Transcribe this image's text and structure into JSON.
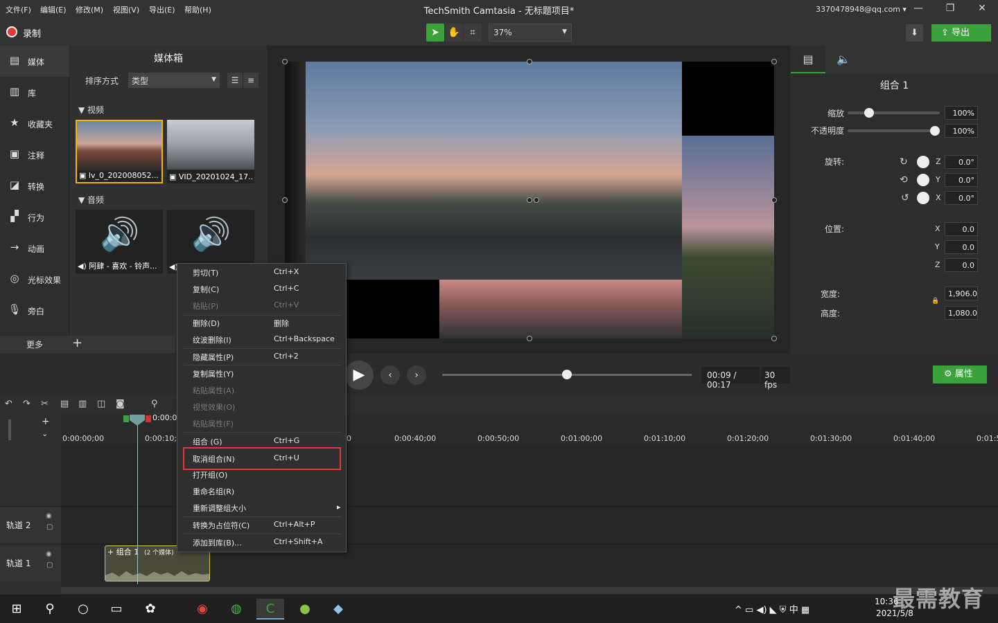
{
  "menubar": {
    "items": [
      "文件(F)",
      "编辑(E)",
      "修改(M)",
      "视图(V)",
      "导出(E)",
      "帮助(H)"
    ],
    "title": "TechSmith Camtasia - 无标题项目*",
    "account": "3370478948@qq.com ▾"
  },
  "toolbar": {
    "record": "录制",
    "zoom": "37%",
    "export": "导出"
  },
  "sidebar": {
    "items": [
      {
        "label": "媒体",
        "icon": "film-icon"
      },
      {
        "label": "库",
        "icon": "library-icon"
      },
      {
        "label": "收藏夹",
        "icon": "star-icon"
      },
      {
        "label": "注释",
        "icon": "annotation-icon"
      },
      {
        "label": "转换",
        "icon": "transition-icon"
      },
      {
        "label": "行为",
        "icon": "behavior-icon"
      },
      {
        "label": "动画",
        "icon": "animation-icon"
      },
      {
        "label": "光标效果",
        "icon": "cursor-icon"
      },
      {
        "label": "旁白",
        "icon": "microphone-icon"
      }
    ],
    "more": "更多"
  },
  "media_bin": {
    "title": "媒体箱",
    "sort_label": "排序方式",
    "sort_value": "类型",
    "video_section": "视频",
    "audio_section": "音频",
    "videos": [
      "lv_0_202008052...",
      "VID_20201024_17..."
    ],
    "audios": [
      "阿肆 - 喜欢 - 铃声...",
      ""
    ]
  },
  "properties": {
    "title": "组合 1",
    "scale_label": "缩放",
    "scale_value": "100%",
    "scale_fraction": 0.2,
    "opacity_label": "不透明度",
    "opacity_value": "100%",
    "opacity_fraction": 1.0,
    "rotation_label": "旋转:",
    "rotation": [
      {
        "axis": "Z",
        "value": "0.0°"
      },
      {
        "axis": "Y",
        "value": "0.0°"
      },
      {
        "axis": "X",
        "value": "0.0°"
      }
    ],
    "position_label": "位置:",
    "position": [
      {
        "axis": "X",
        "value": "0.0"
      },
      {
        "axis": "Y",
        "value": "0.0"
      },
      {
        "axis": "Z",
        "value": "0.0"
      }
    ],
    "width_label": "宽度:",
    "width_value": "1,906.0",
    "height_label": "高度:",
    "height_value": "1,080.0"
  },
  "playback": {
    "time": "00:09 / 00:17",
    "fps": "30 fps",
    "progress": 0.5,
    "properties_button": "属性"
  },
  "timeline": {
    "playhead_time": "0:00:0",
    "ticks": [
      "0:00:00;00",
      "0:00:10;0",
      "0",
      "0:00:40;00",
      "0:00:50;00",
      "0:01:00;00",
      "0:01:10;00",
      "0:01:20;00",
      "0:01:30;00",
      "0:01:40;00",
      "0:01:5"
    ],
    "tracks": [
      "轨道 2",
      "轨道 1"
    ],
    "clip_label": "+ 组合 1",
    "clip_sub": "(2 个媒体)"
  },
  "context_menu": {
    "items": [
      {
        "label": "剪切(T)",
        "key": "Ctrl+X",
        "disabled": false
      },
      {
        "label": "复制(C)",
        "key": "Ctrl+C",
        "disabled": false
      },
      {
        "label": "粘贴(P)",
        "key": "Ctrl+V",
        "disabled": true
      },
      {
        "label": "删除(D)",
        "key": "删除",
        "disabled": false
      },
      {
        "label": "纹波删除(I)",
        "key": "Ctrl+Backspace",
        "disabled": false
      },
      {
        "label": "隐藏属性(P)",
        "key": "Ctrl+2",
        "disabled": false
      },
      {
        "label": "复制属性(Y)",
        "key": "",
        "disabled": false
      },
      {
        "label": "粘贴属性(A)",
        "key": "",
        "disabled": true
      },
      {
        "label": "视觉效果(O)",
        "key": "",
        "disabled": true
      },
      {
        "label": "粘贴属性(F)",
        "key": "",
        "disabled": true
      },
      {
        "label": "组合 (G)",
        "key": "Ctrl+G",
        "disabled": false
      },
      {
        "label": "取消组合(N)",
        "key": "Ctrl+U",
        "disabled": false
      },
      {
        "label": "打开组(O)",
        "key": "",
        "disabled": false
      },
      {
        "label": "重命名组(R)",
        "key": "",
        "disabled": false
      },
      {
        "label": "重新调整组大小",
        "key": "▸",
        "disabled": false
      },
      {
        "label": "转换为占位符(C)",
        "key": "Ctrl+Alt+P",
        "disabled": false
      },
      {
        "label": "添加到库(B)...",
        "key": "Ctrl+Shift+A",
        "disabled": false
      }
    ]
  },
  "taskbar": {
    "ime": "中",
    "time": "10:36",
    "date": "2021/5/8"
  },
  "watermark": "最需教育",
  "colors": {
    "accent": "#3ba23b",
    "record": "#e53935",
    "selection": "#f5b400",
    "highlight": "#e53935"
  }
}
